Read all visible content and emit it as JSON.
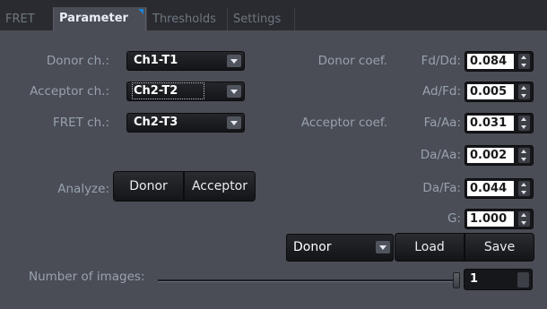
{
  "tabs": [
    {
      "label": "FRET"
    },
    {
      "label": "Parameter"
    },
    {
      "label": "Thresholds"
    },
    {
      "label": "Settings"
    }
  ],
  "active_tab": "Parameter",
  "channels": {
    "donor_label": "Donor ch.:",
    "donor_value": "Ch1-T1",
    "acceptor_label": "Acceptor ch.:",
    "acceptor_value": "Ch2-T2",
    "fret_label": "FRET ch.:",
    "fret_value": "Ch2-T3"
  },
  "analyze": {
    "label": "Analyze:",
    "donor_button": "Donor",
    "acceptor_button": "Acceptor"
  },
  "coefficients": {
    "donor_coef_label": "Donor coef.",
    "acceptor_coef_label": "Acceptor coef.",
    "fd_dd": {
      "label": "Fd/Dd:",
      "value": "0.084"
    },
    "ad_fd": {
      "label": "Ad/Fd:",
      "value": "0.005"
    },
    "fa_aa": {
      "label": "Fa/Aa:",
      "value": "0.031"
    },
    "da_aa": {
      "label": "Da/Aa:",
      "value": "0.002"
    },
    "da_fa": {
      "label": "Da/Fa:",
      "value": "0.044"
    },
    "g": {
      "label": "G:",
      "value": "1.000"
    }
  },
  "preset": {
    "selected": "Donor",
    "load_button": "Load",
    "save_button": "Save"
  },
  "images": {
    "label": "Number of images:",
    "value": "1"
  },
  "colors": {
    "accent": "#1c84d6",
    "panel": "#4a4d55"
  }
}
